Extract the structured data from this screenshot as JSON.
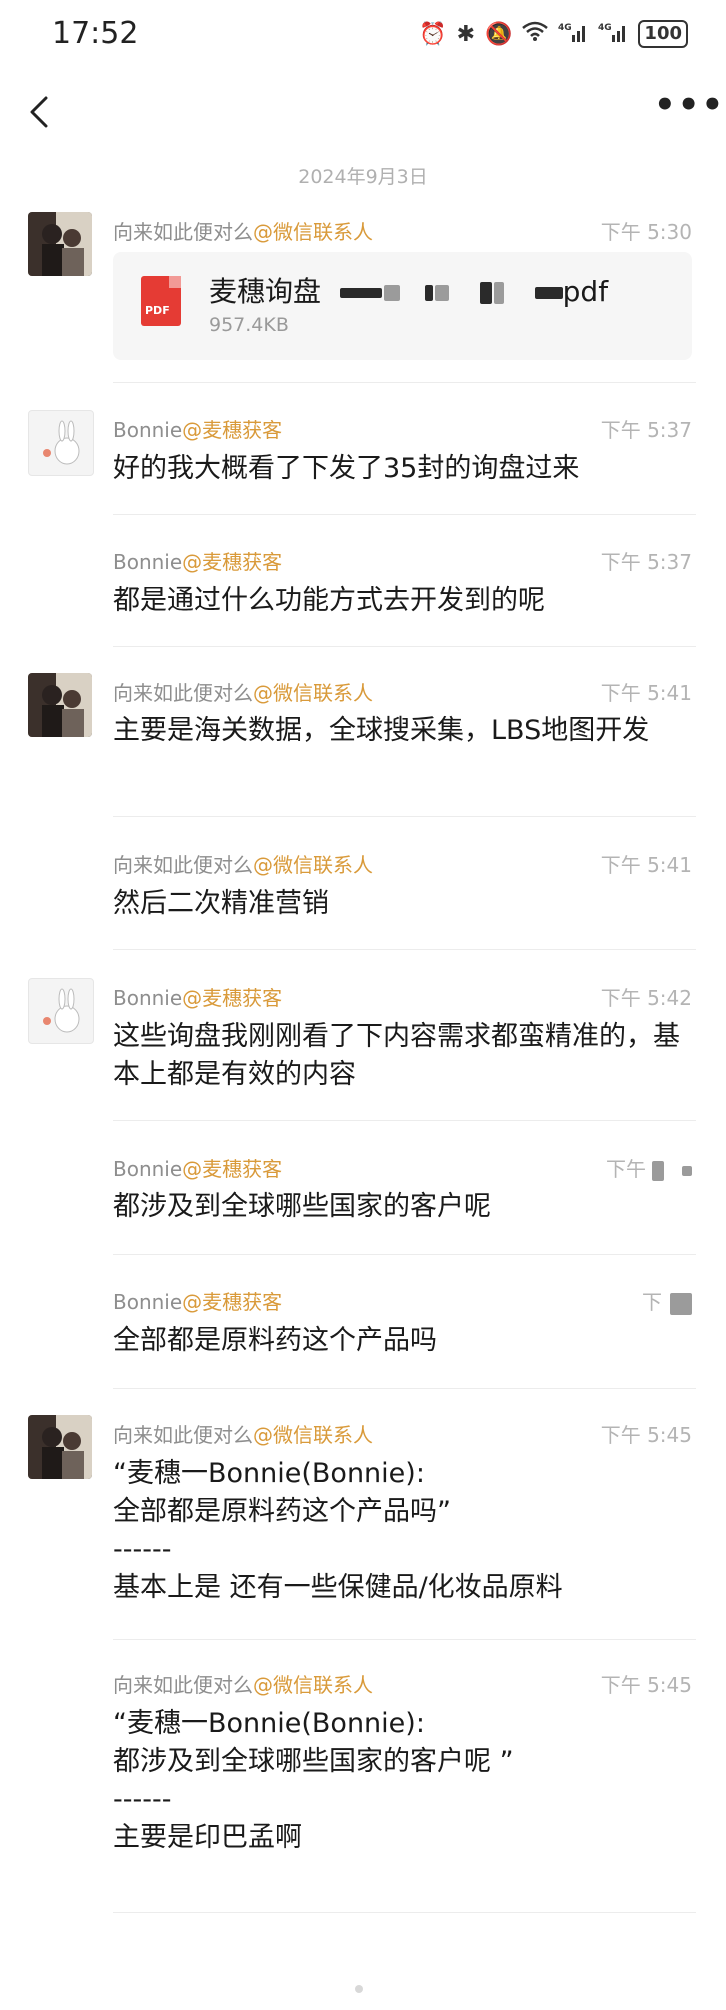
{
  "status_bar": {
    "time": "17:52",
    "icons": [
      "alarm-icon",
      "bluetooth-icon",
      "mute-icon",
      "wifi-icon",
      "signal-4g-icon",
      "signal-4g-icon"
    ],
    "battery": "100"
  },
  "nav": {
    "back_icon": "chevron-left-icon",
    "more_icon": "more-icon",
    "more_glyph": "•••"
  },
  "date_divider": "2024年9月3日",
  "contacts": {
    "a_name": "向来如此便对么",
    "a_tag": "@微信联系人",
    "b_name": "Bonnie",
    "b_tag": "@麦穗获客"
  },
  "file_message": {
    "time": "下午 5:30",
    "file_name_prefix": "麦穗询盘",
    "file_name_suffix": "pdf",
    "file_size": "957.4KB",
    "file_icon_label": "PDF"
  },
  "messages": [
    {
      "sender": "b",
      "time": "下午 5:37",
      "text": "好的我大概看了下发了35封的询盘过来"
    },
    {
      "sender": "b",
      "time": "下午 5:37",
      "text": "都是通过什么功能方式去开发到的呢"
    },
    {
      "sender": "a",
      "time": "下午 5:41",
      "text": "主要是海关数据，全球搜采集，LBS地图开发"
    },
    {
      "sender": "a",
      "time": "下午 5:41",
      "text": "然后二次精准营销"
    },
    {
      "sender": "b",
      "time": "下午 5:42",
      "text": "这些询盘我刚刚看了下内容需求都蛮精准的，基本上都是有效的内容"
    },
    {
      "sender": "b",
      "time": "下午",
      "text": "都涉及到全球哪些国家的客户呢"
    },
    {
      "sender": "b",
      "time": "下",
      "text": "全部都是原料药这个产品吗"
    },
    {
      "sender": "a",
      "time": "下午 5:45",
      "quote1": "“麦穗一Bonnie(Bonnie):",
      "quote2": "全部都是原料药这个产品吗”",
      "dash": "------",
      "text": "基本上是 还有一些保健品/化妆品原料"
    },
    {
      "sender": "a",
      "time": "下午 5:45",
      "quote1": "“麦穗一Bonnie(Bonnie):",
      "quote2": "都涉及到全球哪些国家的客户呢 ”",
      "dash": "------",
      "text": "主要是印巴孟啊"
    }
  ]
}
